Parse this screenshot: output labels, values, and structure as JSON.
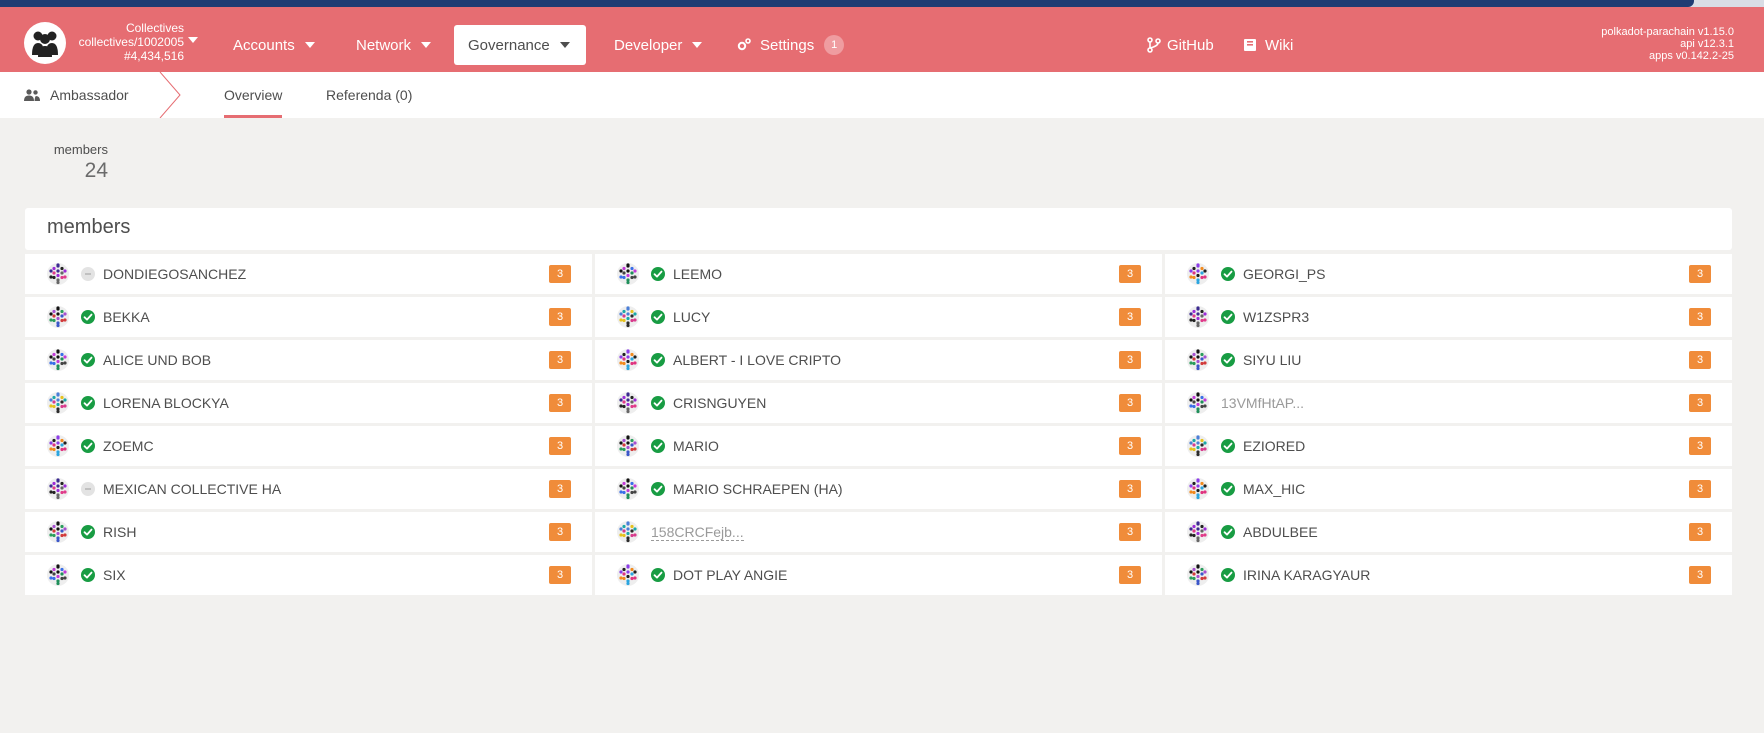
{
  "header": {
    "chain_name": "Collectives",
    "chain_path": "collectives/1002005",
    "block_number": "#4,434,516",
    "menus": [
      {
        "label": "Accounts"
      },
      {
        "label": "Network"
      },
      {
        "label": "Governance"
      },
      {
        "label": "Developer"
      }
    ],
    "settings_label": "Settings",
    "settings_badge": "1",
    "github_label": "GitHub",
    "wiki_label": "Wiki",
    "version_chain": "polkadot-parachain v1.15.0",
    "version_api": "api v12.3.1",
    "version_apps": "apps v0.142.2-25",
    "accent_color": "#e66d72"
  },
  "subnav": {
    "section_label": "Ambassador",
    "tabs": [
      {
        "label": "Overview"
      },
      {
        "label": "Referenda (0)"
      }
    ]
  },
  "summary": {
    "members_label": "members",
    "members_count": "24"
  },
  "members_panel": {
    "title": "members",
    "rows": [
      [
        {
          "name": "DONDIEGOSANCHEZ",
          "status": "none",
          "rank": "3"
        },
        {
          "name": "LEEMO",
          "status": "ok",
          "rank": "3"
        },
        {
          "name": "GEORGI_PS",
          "status": "ok",
          "rank": "3"
        }
      ],
      [
        {
          "name": "BEKKA",
          "status": "ok",
          "rank": "3"
        },
        {
          "name": "LUCY",
          "status": "ok",
          "rank": "3"
        },
        {
          "name": "W1ZSPR3",
          "status": "ok",
          "rank": "3"
        }
      ],
      [
        {
          "name": "ALICE UND BOB",
          "status": "ok",
          "rank": "3"
        },
        {
          "name": "ALBERT - I LOVE CRIPTO",
          "status": "ok",
          "rank": "3"
        },
        {
          "name": "SIYU LIU",
          "status": "ok",
          "rank": "3"
        }
      ],
      [
        {
          "name": "LORENA BLOCKYA",
          "status": "ok",
          "rank": "3"
        },
        {
          "name": "CRISNGUYEN",
          "status": "ok",
          "rank": "3"
        },
        {
          "name": "13VMfHtAP...",
          "status": "addr",
          "rank": "3"
        }
      ],
      [
        {
          "name": "ZOEMC",
          "status": "ok",
          "rank": "3"
        },
        {
          "name": "MARIO",
          "status": "ok",
          "rank": "3"
        },
        {
          "name": "EZIORED",
          "status": "ok",
          "rank": "3"
        }
      ],
      [
        {
          "name": "MEXICAN COLLECTIVE HA",
          "status": "none",
          "rank": "3"
        },
        {
          "name": "MARIO SCHRAEPEN (HA)",
          "status": "ok",
          "rank": "3"
        },
        {
          "name": "MAX_HIC",
          "status": "ok",
          "rank": "3"
        }
      ],
      [
        {
          "name": "RISH",
          "status": "ok",
          "rank": "3"
        },
        {
          "name": "158CRCFejb...",
          "status": "addr-dashed",
          "rank": "3"
        },
        {
          "name": "ABDULBEE",
          "status": "ok",
          "rank": "3"
        }
      ],
      [
        {
          "name": "SIX",
          "status": "ok",
          "rank": "3"
        },
        {
          "name": "DOT PLAY ANGIE",
          "status": "ok",
          "rank": "3"
        },
        {
          "name": "IRINA KARAGYAUR",
          "status": "ok",
          "rank": "3"
        }
      ]
    ]
  }
}
